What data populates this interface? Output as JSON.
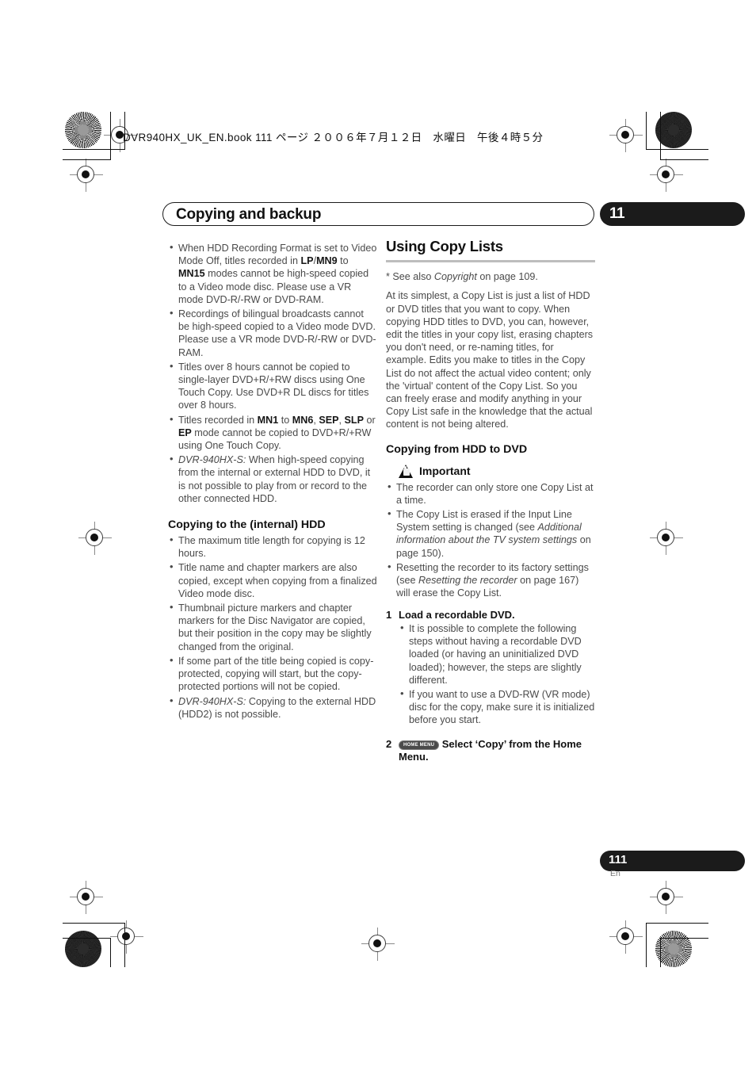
{
  "header": {
    "book_info": "DVR940HX_UK_EN.book  111 ページ  ２００６年７月１２日　水曜日　午後４時５分"
  },
  "chapter": {
    "title": "Copying and backup",
    "number": "11"
  },
  "footer": {
    "page_number": "111",
    "language": "En"
  },
  "left_column": {
    "notes": [
      "When HDD Recording Format is set to Video Mode Off, titles recorded in <b>LP</b>/<b>MN9</b> to <b>MN15</b> modes cannot be high-speed copied to a Video mode disc. Please use a VR mode DVD-R/-RW or DVD-RAM.",
      "Recordings of bilingual broadcasts cannot be high-speed copied to a Video mode DVD. Please use a VR mode DVD-R/-RW or DVD-RAM.",
      "Titles over 8 hours cannot be copied to single-layer DVD+R/+RW discs using One Touch Copy. Use DVD+R DL discs for titles over 8 hours.",
      "Titles recorded in <b>MN1</b> to <b>MN6</b>, <b>SEP</b>, <b>SLP</b> or <b>EP</b> mode cannot be copied to DVD+R/+RW using One Touch Copy.",
      "<i>DVR-940HX-S:</i> When high-speed copying from the internal or external HDD to DVD, it is not possible to play from or record to the other connected HDD."
    ],
    "section_heading": "Copying to the (internal) HDD",
    "section_notes": [
      "The maximum title length for copying is 12 hours.",
      "Title name and chapter markers are also copied, except when copying from a finalized Video mode disc.",
      "Thumbnail picture markers and chapter markers for the Disc Navigator are copied, but their position in the copy may be slightly changed from the original.",
      "If some part of the title being copied is copy-protected, copying will start, but the copy-protected portions will not be copied.",
      "<i>DVR-940HX-S:</i> Copying to the external HDD (HDD2) is not possible."
    ]
  },
  "right_column": {
    "title": "Using Copy Lists",
    "see_also": "* See also <i>Copyright</i> on page 109.",
    "intro": "At its simplest, a Copy List is just a list of HDD or DVD titles that you want to copy. When copying HDD titles to DVD, you can, however, edit the titles in your copy list, erasing chapters you don't need, or re-naming titles, for example. Edits you make to titles in the Copy List do not affect the actual video content; only the 'virtual' content of the Copy List. So you can freely erase and modify anything in your Copy List safe in the knowledge that the actual content is not being altered.",
    "subsection": "Copying from HDD to DVD",
    "important_label": "Important",
    "important_notes": [
      "The recorder can only store one Copy List at a time.",
      "The Copy List is erased if the Input Line System setting is changed (see <i>Additional information about the TV system settings</i> on page 150).",
      "Resetting the recorder to its factory settings (see <i>Resetting the recorder</i> on page 167) will erase the Copy List."
    ],
    "steps": [
      {
        "number": "1",
        "title": "Load a recordable DVD.",
        "badge": "",
        "notes": [
          "It is possible to complete the following steps without having a recordable DVD loaded (or having an uninitialized DVD loaded); however, the steps are slightly different.",
          "If you want to use a DVD-RW (VR mode) disc for the copy, make sure it is initialized before you start."
        ]
      },
      {
        "number": "2",
        "title": "Select &lsquo;Copy&rsquo; from the Home Menu.",
        "badge": "HOME MENU",
        "notes": []
      }
    ]
  }
}
